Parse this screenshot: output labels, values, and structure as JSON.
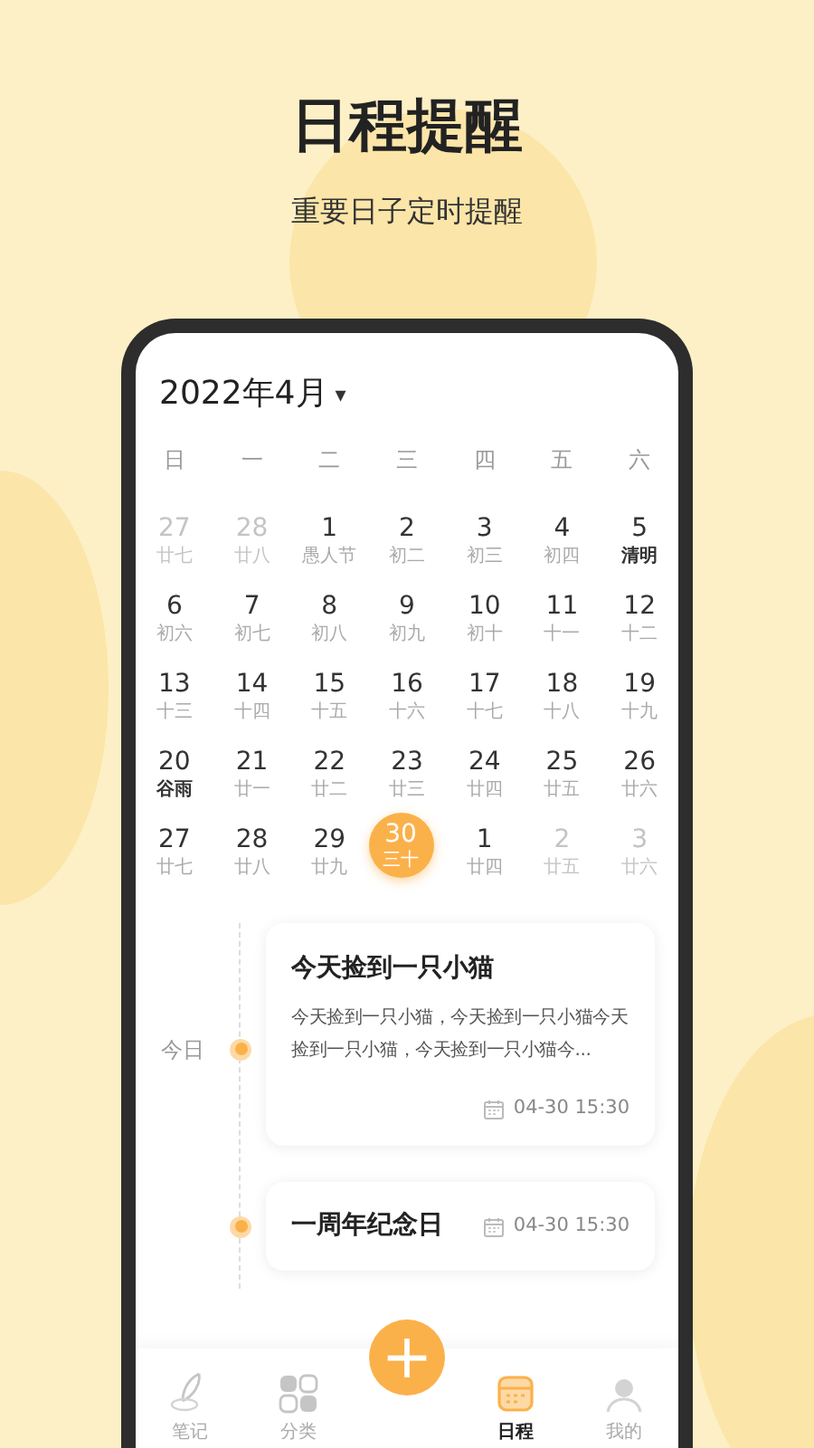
{
  "headline": "日程提醒",
  "subtitle": "重要日子定时提醒",
  "calendar": {
    "month": "2022年4月",
    "dropdown": "▾",
    "weekdays": [
      "日",
      "一",
      "二",
      "三",
      "四",
      "五",
      "六"
    ],
    "days": [
      {
        "day": "27",
        "lunar": "廿七",
        "muted": true,
        "festival": false,
        "selected": false
      },
      {
        "day": "28",
        "lunar": "廿八",
        "muted": true,
        "festival": false,
        "selected": false
      },
      {
        "day": "1",
        "lunar": "愚人节",
        "muted": false,
        "festival": false,
        "selected": false
      },
      {
        "day": "2",
        "lunar": "初二",
        "muted": false,
        "festival": false,
        "selected": false
      },
      {
        "day": "3",
        "lunar": "初三",
        "muted": false,
        "festival": false,
        "selected": false
      },
      {
        "day": "4",
        "lunar": "初四",
        "muted": false,
        "festival": false,
        "selected": false
      },
      {
        "day": "5",
        "lunar": "清明",
        "muted": false,
        "festival": true,
        "selected": false
      },
      {
        "day": "6",
        "lunar": "初六",
        "muted": false,
        "festival": false,
        "selected": false
      },
      {
        "day": "7",
        "lunar": "初七",
        "muted": false,
        "festival": false,
        "selected": false
      },
      {
        "day": "8",
        "lunar": "初八",
        "muted": false,
        "festival": false,
        "selected": false
      },
      {
        "day": "9",
        "lunar": "初九",
        "muted": false,
        "festival": false,
        "selected": false
      },
      {
        "day": "10",
        "lunar": "初十",
        "muted": false,
        "festival": false,
        "selected": false
      },
      {
        "day": "11",
        "lunar": "十一",
        "muted": false,
        "festival": false,
        "selected": false
      },
      {
        "day": "12",
        "lunar": "十二",
        "muted": false,
        "festival": false,
        "selected": false
      },
      {
        "day": "13",
        "lunar": "十三",
        "muted": false,
        "festival": false,
        "selected": false
      },
      {
        "day": "14",
        "lunar": "十四",
        "muted": false,
        "festival": false,
        "selected": false
      },
      {
        "day": "15",
        "lunar": "十五",
        "muted": false,
        "festival": false,
        "selected": false
      },
      {
        "day": "16",
        "lunar": "十六",
        "muted": false,
        "festival": false,
        "selected": false
      },
      {
        "day": "17",
        "lunar": "十七",
        "muted": false,
        "festival": false,
        "selected": false
      },
      {
        "day": "18",
        "lunar": "十八",
        "muted": false,
        "festival": false,
        "selected": false
      },
      {
        "day": "19",
        "lunar": "十九",
        "muted": false,
        "festival": false,
        "selected": false
      },
      {
        "day": "20",
        "lunar": "谷雨",
        "muted": false,
        "festival": true,
        "selected": false
      },
      {
        "day": "21",
        "lunar": "廿一",
        "muted": false,
        "festival": false,
        "selected": false
      },
      {
        "day": "22",
        "lunar": "廿二",
        "muted": false,
        "festival": false,
        "selected": false
      },
      {
        "day": "23",
        "lunar": "廿三",
        "muted": false,
        "festival": false,
        "selected": false
      },
      {
        "day": "24",
        "lunar": "廿四",
        "muted": false,
        "festival": false,
        "selected": false
      },
      {
        "day": "25",
        "lunar": "廿五",
        "muted": false,
        "festival": false,
        "selected": false
      },
      {
        "day": "26",
        "lunar": "廿六",
        "muted": false,
        "festival": false,
        "selected": false
      },
      {
        "day": "27",
        "lunar": "廿七",
        "muted": false,
        "festival": false,
        "selected": false
      },
      {
        "day": "28",
        "lunar": "廿八",
        "muted": false,
        "festival": false,
        "selected": false
      },
      {
        "day": "29",
        "lunar": "廿九",
        "muted": false,
        "festival": false,
        "selected": false
      },
      {
        "day": "30",
        "lunar": "三十",
        "muted": false,
        "festival": false,
        "selected": true
      },
      {
        "day": "1",
        "lunar": "廿四",
        "muted": false,
        "festival": false,
        "selected": false
      },
      {
        "day": "2",
        "lunar": "廿五",
        "muted": true,
        "festival": false,
        "selected": false
      },
      {
        "day": "3",
        "lunar": "廿六",
        "muted": true,
        "festival": false,
        "selected": false
      }
    ]
  },
  "timeline": {
    "today_label": "今日",
    "events": [
      {
        "title": "今天捡到一只小猫",
        "body": "今天捡到一只小猫，今天捡到一只小猫今天捡到一只小猫，今天捡到一只小猫今...",
        "time": "04-30 15:30"
      },
      {
        "title": "一周年纪念日",
        "time": "04-30 15:30"
      }
    ]
  },
  "nav": {
    "add": "+",
    "items": [
      {
        "kind": "notes",
        "label": "笔记",
        "selected": false
      },
      {
        "kind": "categories",
        "label": "分类",
        "selected": false
      },
      {
        "kind": "schedule",
        "label": "日程",
        "selected": true
      },
      {
        "kind": "profile",
        "label": "我的",
        "selected": false
      }
    ]
  }
}
